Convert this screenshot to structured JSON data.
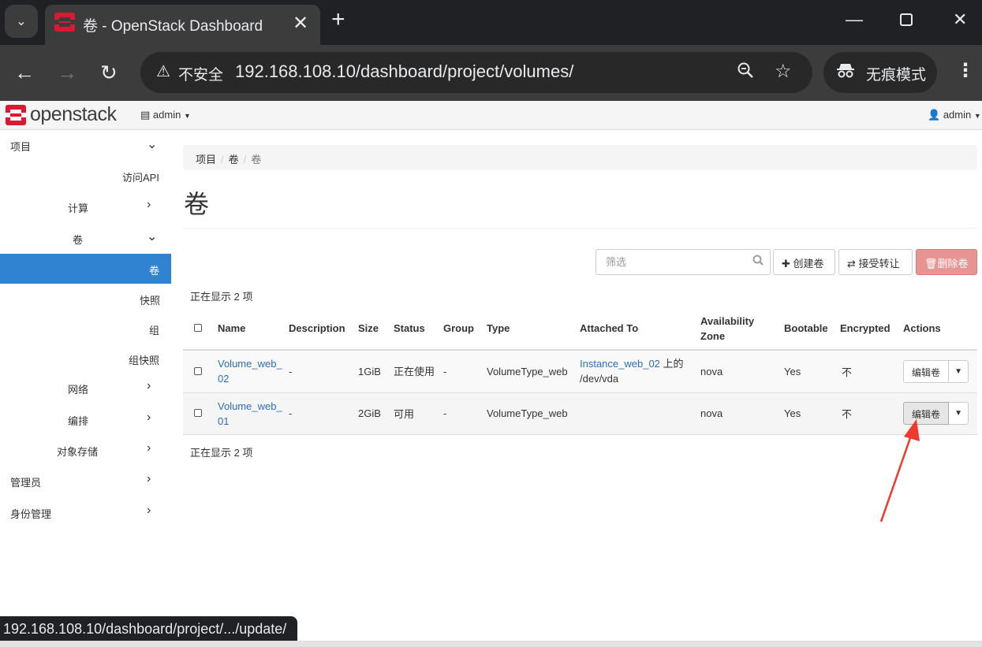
{
  "browser": {
    "tab_title": "卷 - OpenStack Dashboard",
    "security_label": "不安全",
    "url": "192.168.108.10/dashboard/project/volumes/",
    "incognito_label": "无痕模式",
    "status_url": "192.168.108.10/dashboard/project/.../update/"
  },
  "header": {
    "brand": "openstack",
    "project": "admin",
    "user": "admin"
  },
  "sidebar": {
    "items": [
      {
        "label": "项目"
      },
      {
        "label": "访问API"
      },
      {
        "label": "计算"
      },
      {
        "label": "卷"
      },
      {
        "label": "卷"
      },
      {
        "label": "快照"
      },
      {
        "label": "组"
      },
      {
        "label": "组快照"
      },
      {
        "label": "网络"
      },
      {
        "label": "编排"
      },
      {
        "label": "对象存储"
      },
      {
        "label": "管理员"
      },
      {
        "label": "身份管理"
      }
    ]
  },
  "breadcrumb": [
    "项目",
    "卷",
    "卷"
  ],
  "page_title": "卷",
  "actions": {
    "filter_placeholder": "筛选",
    "create": "创建卷",
    "accept_transfer": "接受转让",
    "delete": "删除卷"
  },
  "count_text": "正在显示 2 项",
  "table": {
    "headers": [
      "Name",
      "Description",
      "Size",
      "Status",
      "Group",
      "Type",
      "Attached To",
      "Availability Zone",
      "Bootable",
      "Encrypted",
      "Actions"
    ],
    "rows": [
      {
        "name": "Volume_web_02",
        "description": "-",
        "size": "1GiB",
        "status": "正在使用",
        "group": "-",
        "type": "VolumeType_web",
        "attached_link": "Instance_web_02",
        "attached_suffix": " 上的 /dev/vda",
        "zone": "nova",
        "bootable": "Yes",
        "encrypted": "不",
        "action": "编辑卷"
      },
      {
        "name": "Volume_web_01",
        "description": "-",
        "size": "2GiB",
        "status": "可用",
        "group": "-",
        "type": "VolumeType_web",
        "attached_link": "",
        "attached_suffix": "",
        "zone": "nova",
        "bootable": "Yes",
        "encrypted": "不",
        "action": "编辑卷"
      }
    ]
  },
  "colors": {
    "accent": "#2f83d0",
    "danger_button": "#e79492",
    "annotation_arrow": "#f03a2f",
    "brand_red": "#da1a32"
  }
}
